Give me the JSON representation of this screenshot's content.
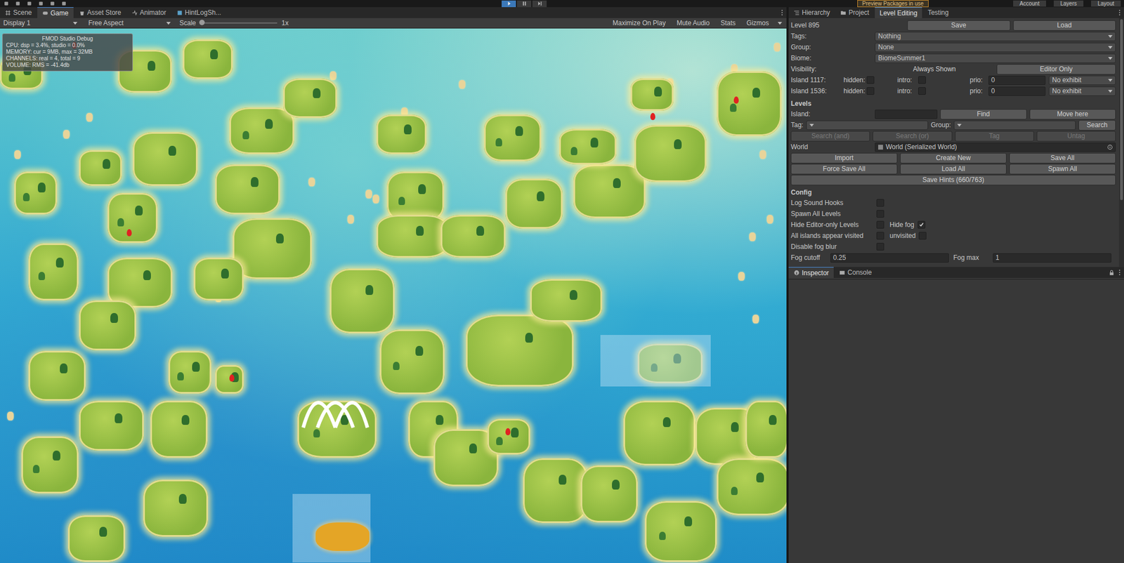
{
  "top_bar": {
    "playing": true,
    "packages": "Preview Packages in use",
    "account": "Account",
    "layers": "Layers",
    "layout": "Layout"
  },
  "game_tabs": [
    {
      "label": "Scene",
      "selected": false
    },
    {
      "label": "Game",
      "selected": true
    },
    {
      "label": "Asset Store",
      "selected": false
    },
    {
      "label": "Animator",
      "selected": false
    },
    {
      "label": "HintLogSh...",
      "selected": false
    }
  ],
  "game_toolbar": {
    "display": "Display 1",
    "aspect": "Free Aspect",
    "scale_label": "Scale",
    "scale_value": "1x",
    "scale_level": 0.0,
    "buttons": [
      {
        "label": "Maximize On Play",
        "on": false
      },
      {
        "label": "Mute Audio",
        "on": false
      },
      {
        "label": "Stats",
        "on": false
      },
      {
        "label": "Gizmos",
        "on": false
      }
    ]
  },
  "fmod": {
    "title": "FMOD Studio Debug",
    "lines": [
      "CPU: dsp = 3.4%, studio = 0.0%",
      "MEMORY: cur = 9MB, max = 32MB",
      "CHANNELS: real = 4, total = 9",
      "VOLUME: RMS = -41.4db"
    ]
  },
  "side_tabs": [
    {
      "label": "Hierarchy",
      "selected": false
    },
    {
      "label": "Project",
      "selected": false
    },
    {
      "label": "Level Editing",
      "selected": true
    },
    {
      "label": "Testing",
      "selected": false
    }
  ],
  "level": {
    "title": "Level 895",
    "save": "Save",
    "load": "Load"
  },
  "fields": [
    {
      "label": "Tags:",
      "value": "Nothing"
    },
    {
      "label": "Group:",
      "value": "None"
    },
    {
      "label": "Biome:",
      "value": "BiomeSummer1"
    }
  ],
  "visibility": {
    "label": "Visibility:",
    "options": [
      {
        "label": "Always Shown",
        "selected": true
      },
      {
        "label": "Editor Only",
        "selected": false
      }
    ]
  },
  "islands": [
    {
      "name": "Island 1117:",
      "hidden_label": "hidden:",
      "hidden": false,
      "intro_label": "intro:",
      "intro": false,
      "prio_label": "prio:",
      "prio": "0",
      "exhibit": "No exhibit"
    },
    {
      "name": "Island 1536:",
      "hidden_label": "hidden:",
      "hidden": false,
      "intro_label": "intro:",
      "intro": false,
      "prio_label": "prio:",
      "prio": "0",
      "exhibit": "No exhibit"
    }
  ],
  "levels": {
    "title": "Levels",
    "island_label": "Island:",
    "find": "Find",
    "move": "Move here",
    "tag_label": "Tag:",
    "group_label": "Group:",
    "search": "Search",
    "search_buttons": [
      {
        "label": "Search (and)",
        "disabled": true
      },
      {
        "label": "Search (or)",
        "disabled": true
      },
      {
        "label": "Tag",
        "disabled": true
      },
      {
        "label": "Untag",
        "disabled": true
      }
    ],
    "world_label": "World",
    "world_value": "World (Serialized World)",
    "button_rows": [
      [
        "Import",
        "Create New",
        "Save All"
      ],
      [
        "Force Save All",
        "Load All",
        "Spawn All"
      ],
      [
        "Save Hints (660/763)"
      ]
    ]
  },
  "config": {
    "title": "Config",
    "rows": [
      [
        {
          "kind": "toggle",
          "label": "Log Sound Hooks",
          "checked": false
        }
      ],
      [
        {
          "kind": "toggle",
          "label": "Spawn All Levels",
          "checked": false
        }
      ],
      [
        {
          "kind": "toggle",
          "label": "Hide Editor-only Levels",
          "checked": false
        },
        {
          "kind": "toggle",
          "label": "Hide fog",
          "checked": true
        }
      ],
      [
        {
          "kind": "toggle",
          "label": "All islands appear visited",
          "checked": false
        },
        {
          "kind": "toggle",
          "label": "unvisited",
          "checked": false
        }
      ],
      [
        {
          "kind": "toggle",
          "label": "Disable fog blur",
          "checked": false
        }
      ],
      [
        {
          "kind": "number",
          "label": "Fog cutoff",
          "value": "0.25"
        },
        {
          "kind": "number",
          "label": "Fog max",
          "value": "1"
        }
      ]
    ]
  },
  "bottom_tabs": [
    {
      "label": "Inspector",
      "selected": true
    },
    {
      "label": "Console",
      "selected": false
    }
  ]
}
